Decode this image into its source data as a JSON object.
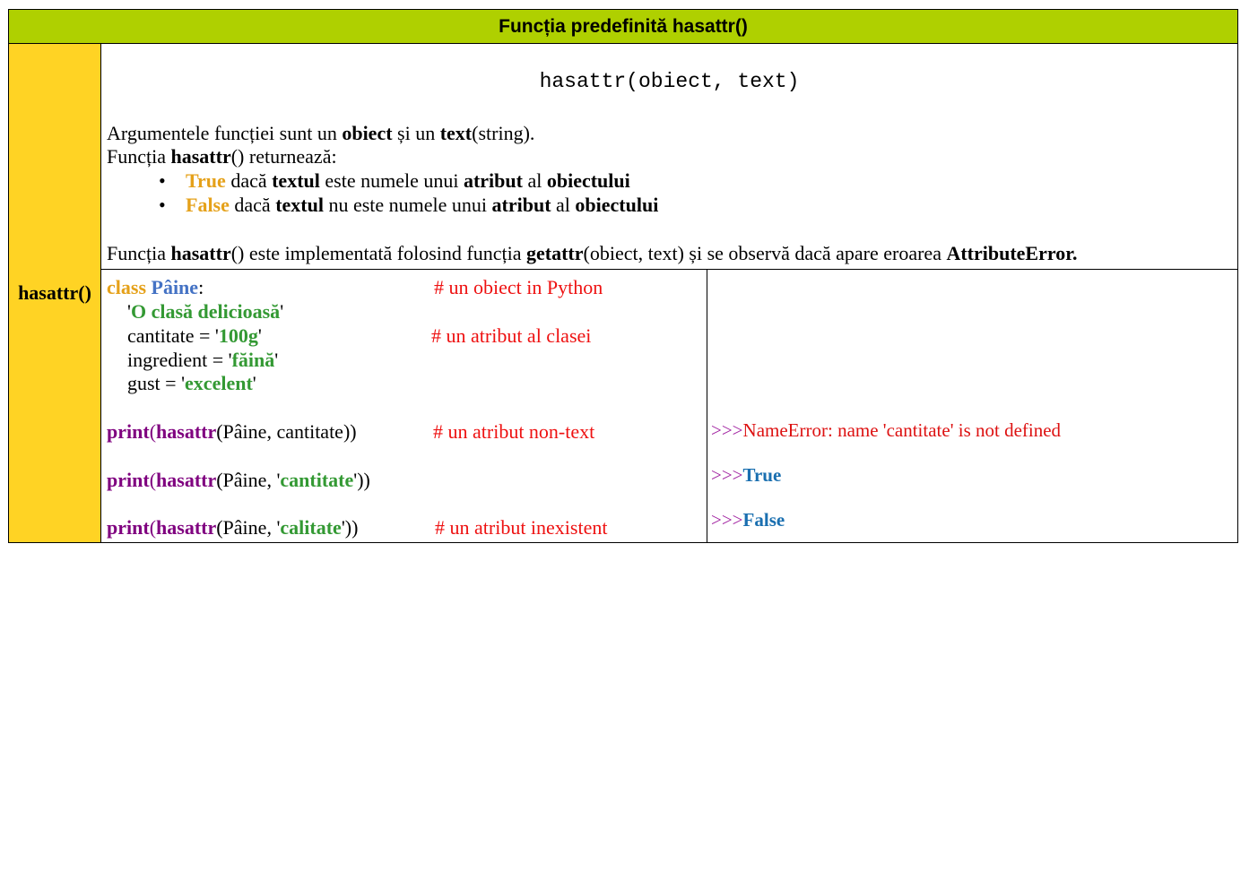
{
  "title": "Funcția predefinită hasattr()",
  "side_label": "hasattr()",
  "signature": "hasattr(obiect, text)",
  "description": {
    "l1": {
      "a": "Argumentele funcției sunt un ",
      "b": "obiect",
      "c": " și un ",
      "d": "text",
      "e": "(string)."
    },
    "l2": {
      "a": "Funcția ",
      "b": "hasattr",
      "c": "() returnează:"
    },
    "bullet_mark": "•",
    "b1": {
      "a": "True",
      "b": " dacă ",
      "c": "textul",
      "d": " este numele unui ",
      "e": "atribut",
      "f": " al ",
      "g": "obiectului"
    },
    "b2": {
      "a": "False",
      "b": " dacă ",
      "c": "textul",
      "d": " nu este numele unui ",
      "e": "atribut",
      "f": " al ",
      "g": "obiectului"
    },
    "l3": {
      "a": "Funcția ",
      "b": "hasattr",
      "c": "() este implementată folosind funcția ",
      "d": "getattr",
      "e": "(obiect, text) și se observă dacă apare eroarea ",
      "f": "AttributeError."
    }
  },
  "code": {
    "c1": {
      "kw": "class",
      "name": "Pâine",
      "colon": ":",
      "comment": "# un obiect in Python"
    },
    "c2": {
      "q1": "'",
      "s": "O clasă delicioasă",
      "q2": "'"
    },
    "c3": {
      "a": "cantitate = '",
      "s": "100g",
      "q": "'",
      "comment": "# un atribut al clasei"
    },
    "c4": {
      "a": "ingredient = '",
      "s": "făină",
      "q": "'"
    },
    "c5": {
      "a": "gust = '",
      "s": "excelent",
      "q": "'"
    },
    "p1": {
      "print": "print",
      "p": "(",
      "fn": "hasattr",
      "args": "(Pâine, cantitate))",
      "comment": "# un atribut non-text"
    },
    "p2": {
      "print": "print",
      "p": "(",
      "fn": "hasattr",
      "a": "(Pâine, '",
      "s": "cantitate",
      "b": "'))"
    },
    "p3": {
      "print": "print",
      "p": "(",
      "fn": "hasattr",
      "a": "(Pâine, '",
      "s": "calitate",
      "b": "'))",
      "comment": "# un atribut inexistent"
    }
  },
  "output": {
    "prompt": ">>>",
    "o1": "NameError: name 'cantitate' is not defined",
    "o2": "True",
    "o3": "False"
  },
  "colors": {
    "title_bg": "#afd000",
    "side_bg": "#ffd324",
    "keyword": "#e5a11a",
    "class_name": "#4472c4",
    "string": "#339933",
    "comment": "#ee1111",
    "function": "#7f007f",
    "output_value": "#1a6fb0"
  }
}
